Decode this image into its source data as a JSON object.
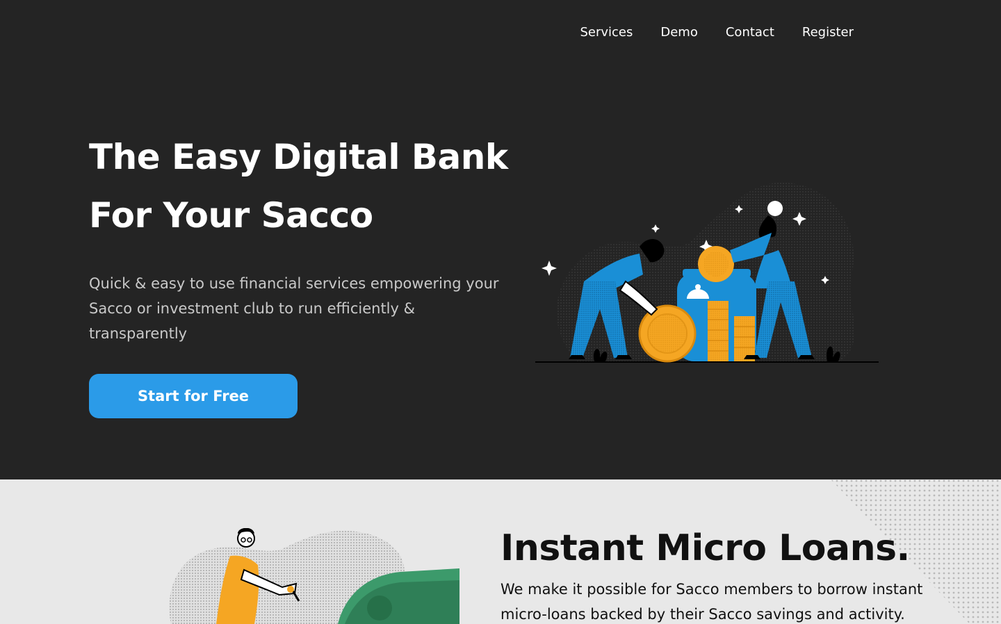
{
  "nav": {
    "items": [
      {
        "label": "Services"
      },
      {
        "label": "Demo"
      },
      {
        "label": "Contact"
      },
      {
        "label": "Register"
      }
    ]
  },
  "hero": {
    "title_line1": "The Easy Digital Bank",
    "title_line2": "For Your Sacco",
    "subtitle": "Quick & easy to use financial services empowering your Sacco or investment club to run efficiently & transparently",
    "cta_label": "Start for Free",
    "illustration": "people-saving-coins-in-jar-illustration"
  },
  "loans": {
    "title": "Instant Micro Loans.",
    "description": "We make it possible for Sacco members to borrow instant micro-loans backed by their Sacco savings and activity.",
    "illustration": "person-pulling-cash-illustration"
  },
  "colors": {
    "hero_bg": "#242424",
    "section_bg": "#e8e8e8",
    "accent": "#2b9be8",
    "coin": "#f5a623",
    "figure_blue": "#1a8fd6",
    "money_green": "#3c9a6b"
  }
}
